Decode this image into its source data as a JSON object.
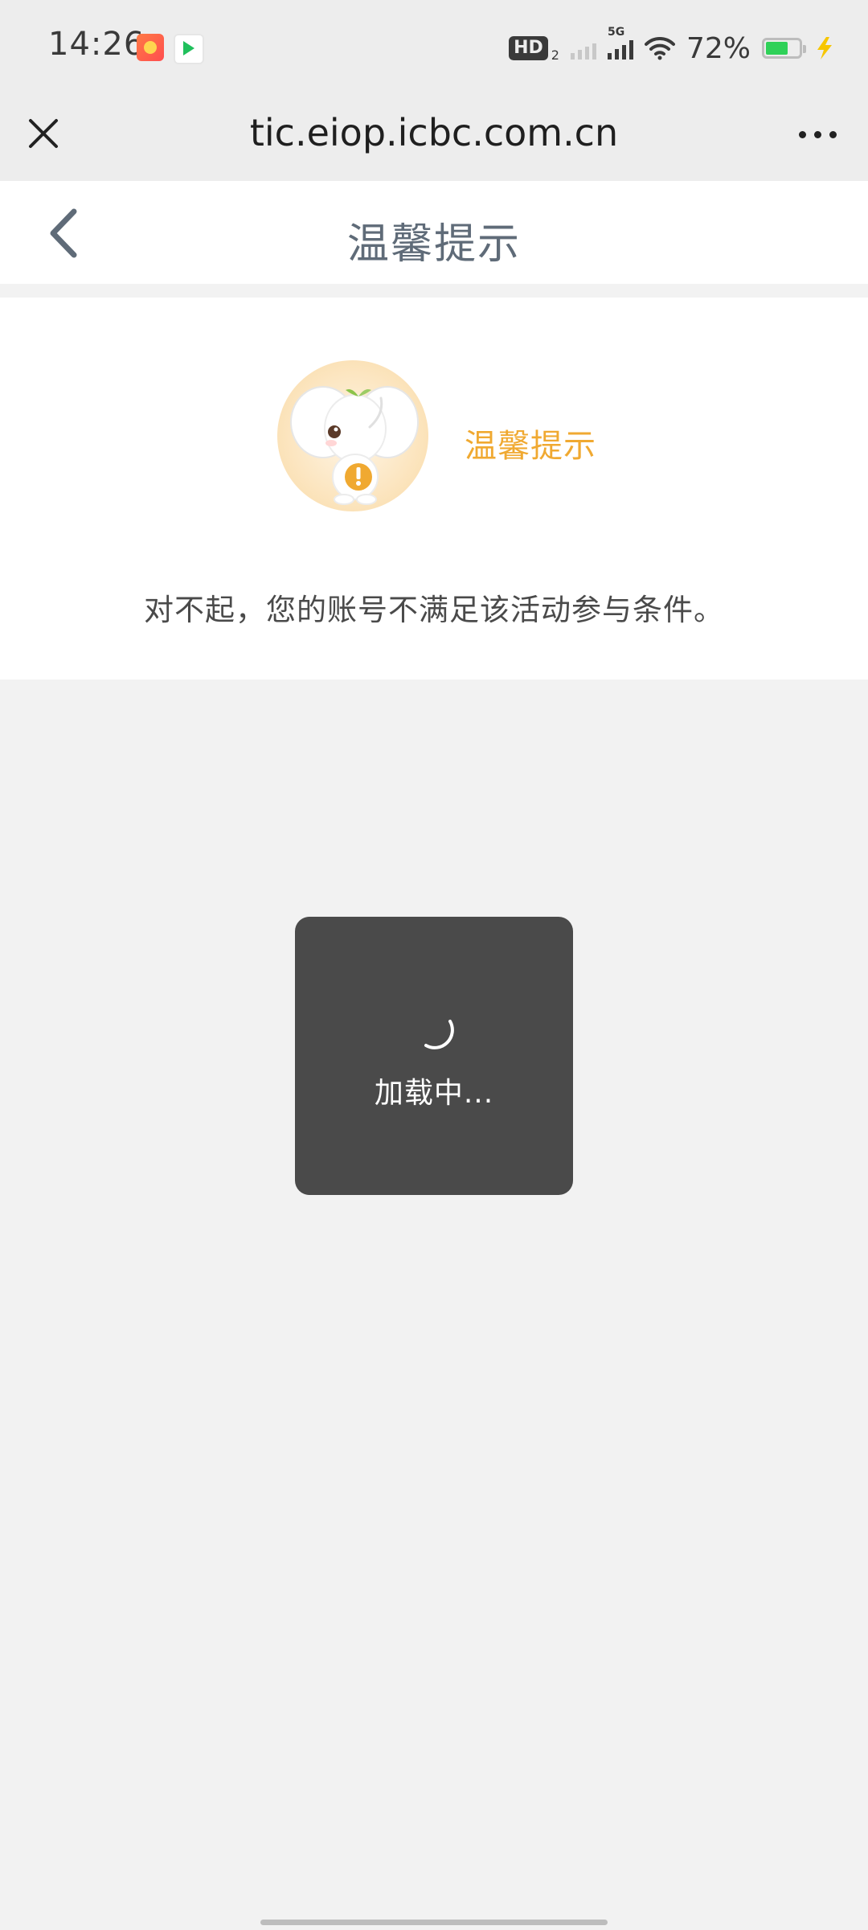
{
  "status_bar": {
    "time": "14:26",
    "hd_label": "HD",
    "hd_sub": "2",
    "network_label": "5G",
    "battery_percent": "72%",
    "battery_level": 0.72,
    "icons": [
      "app-notification-icon",
      "video-app-icon",
      "signal-icon",
      "wifi-icon",
      "battery-icon",
      "charging-icon"
    ]
  },
  "browser": {
    "url": "tic.eiop.icbc.com.cn",
    "close_icon": "close-icon",
    "more_icon": "more-options-icon"
  },
  "header": {
    "title": "温馨提示",
    "back_icon": "back-arrow-icon"
  },
  "notice": {
    "title": "温馨提示",
    "message": "对不起，您的账号不满足该活动参与条件。",
    "mascot_icon": "elephant-mascot-icon"
  },
  "loading": {
    "text": "加载中...",
    "spinner_icon": "spinner-icon"
  },
  "colors": {
    "accent_orange": "#f0a931",
    "header_title": "#5f6b78",
    "toast_bg": "#4a4a4a",
    "page_bg": "#f2f2f2"
  }
}
